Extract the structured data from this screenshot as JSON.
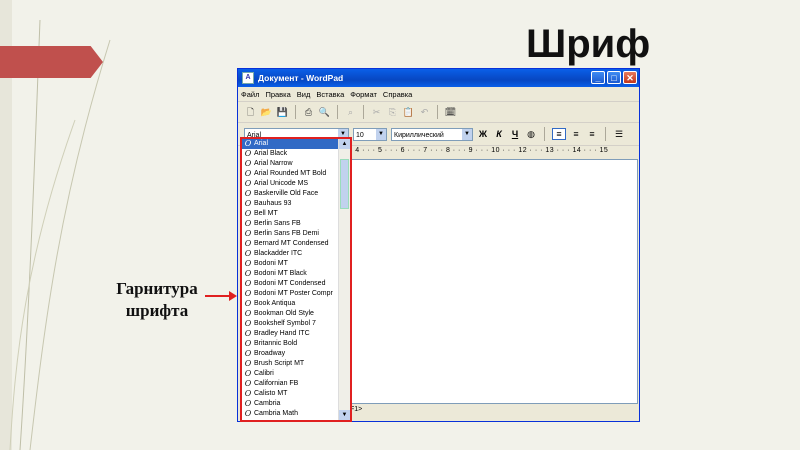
{
  "slide": {
    "title": "Шриф",
    "caption_line1": "Гарнитура",
    "caption_line2": "шрифта"
  },
  "window": {
    "title": "Документ - WordPad",
    "buttons": {
      "minimize": "_",
      "maximize": "□",
      "close": "✕"
    }
  },
  "menu": [
    "Файл",
    "Правка",
    "Вид",
    "Вставка",
    "Формат",
    "Справка"
  ],
  "format_bar": {
    "font_value": "Arial",
    "size_value": "10",
    "script_value": "Кириллический",
    "bold": "Ж",
    "italic": "К",
    "underline": "Ч"
  },
  "ruler": "· 4 · · · 5 · · · 6 · · · 7 · · · 8 · · · 9 · · · 10 · · · 12 · · · 13 · · · 14 · · · 15",
  "status": "F1>",
  "font_list": [
    "Arial",
    "Arial Black",
    "Arial Narrow",
    "Arial Rounded MT Bold",
    "Arial Unicode MS",
    "Baskerville Old Face",
    "Bauhaus 93",
    "Bell MT",
    "Berlin Sans FB",
    "Berlin Sans FB Demi",
    "Bernard MT Condensed",
    "Blackadder ITC",
    "Bodoni MT",
    "Bodoni MT Black",
    "Bodoni MT Condensed",
    "Bodoni MT Poster Compr",
    "Book Antiqua",
    "Bookman Old Style",
    "Bookshelf Symbol 7",
    "Bradley Hand ITC",
    "Britannic Bold",
    "Broadway",
    "Brush Script MT",
    "Calibri",
    "Californian FB",
    "Calisto MT",
    "Cambria",
    "Cambria Math"
  ],
  "colors": {
    "highlight": "#e02020",
    "titlebar": "#0a5fe8",
    "accent": "#c0504d"
  }
}
